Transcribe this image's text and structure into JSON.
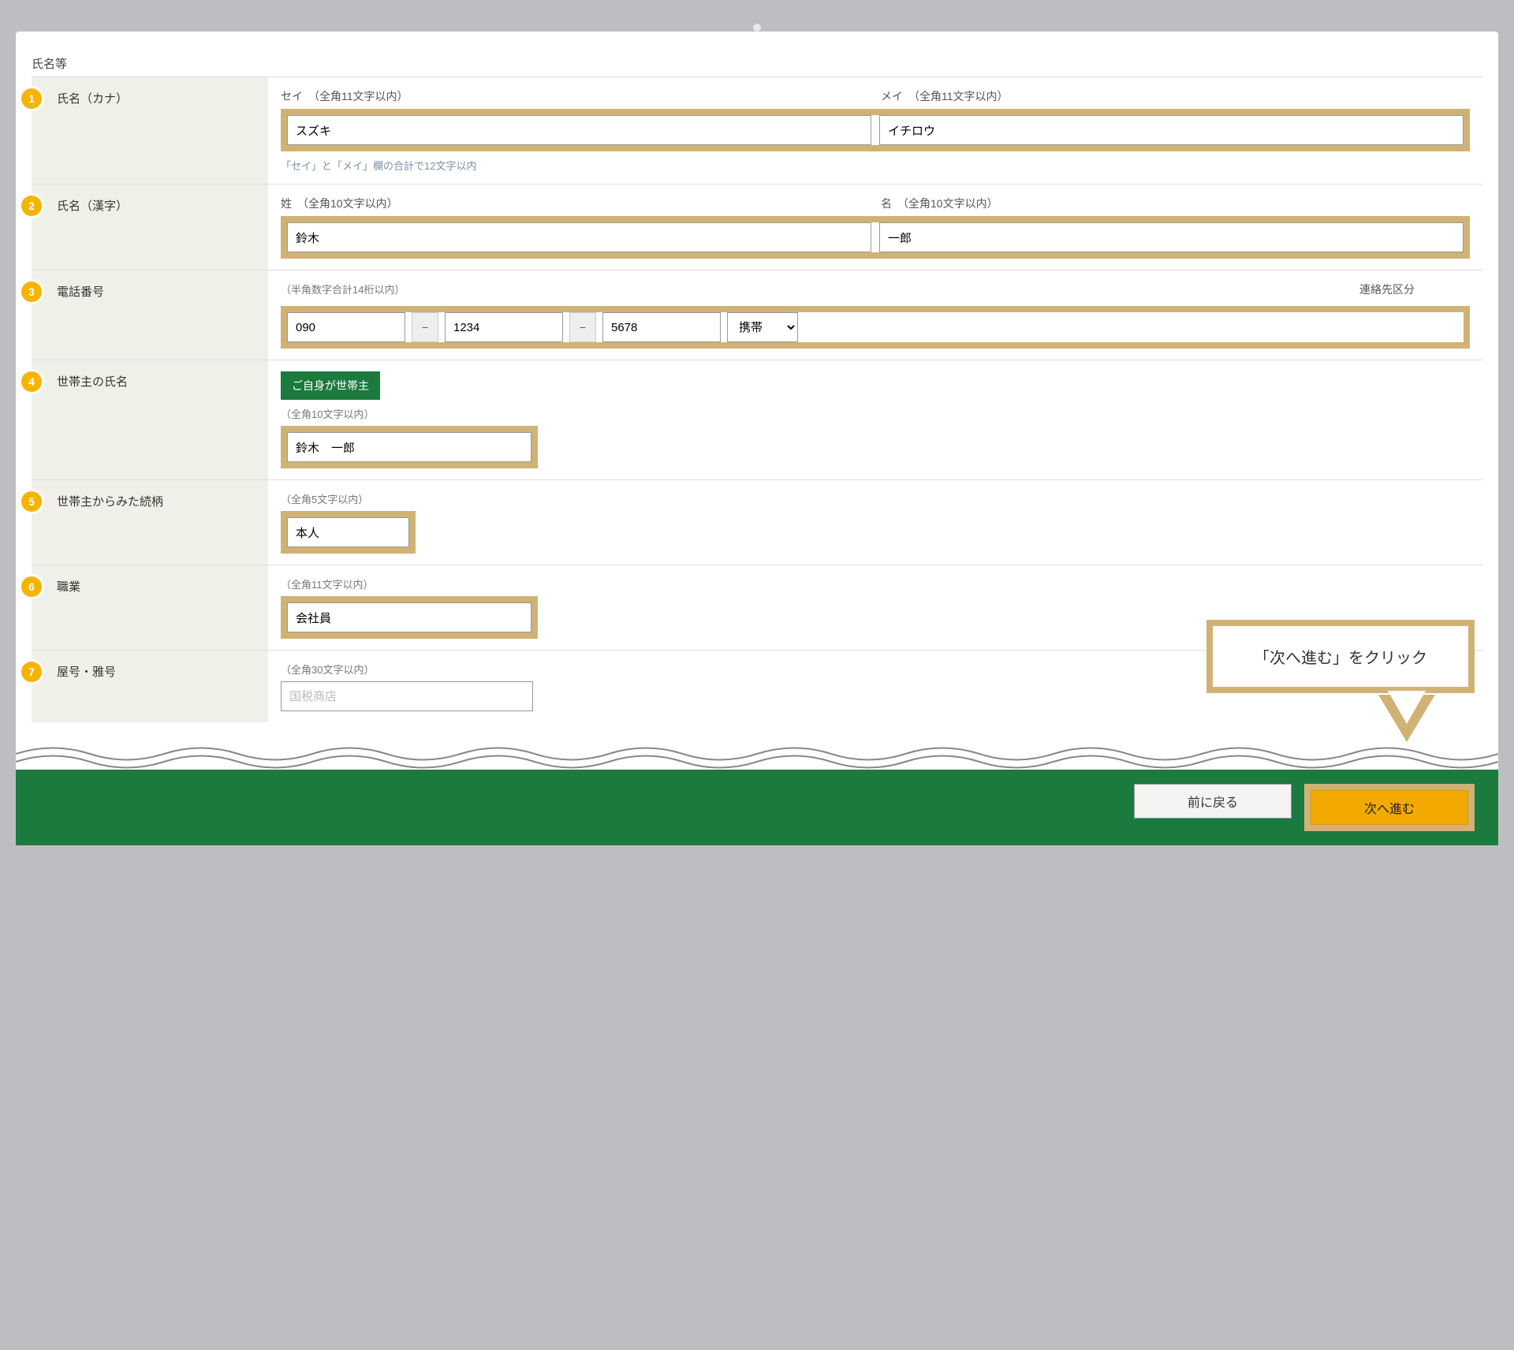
{
  "section_title": "氏名等",
  "rows": {
    "kana": {
      "badge": "1",
      "label": "氏名（カナ）",
      "sub_sei": "セイ　（全角11文字以内）",
      "sub_mei": "メイ　（全角11文字以内）",
      "val_sei": "スズキ",
      "val_mei": "イチロウ",
      "note": "「セイ」と「メイ」欄の合計で12文字以内"
    },
    "kanji": {
      "badge": "2",
      "label": "氏名（漢字）",
      "sub_sei": "姓　（全角10文字以内）",
      "sub_mei": "名　（全角10文字以内）",
      "val_sei": "鈴木",
      "val_mei": "一郎"
    },
    "phone": {
      "badge": "3",
      "label": "電話番号",
      "hint": "（半角数字合計14桁以内）",
      "right_label": "連絡先区分",
      "p1": "090",
      "p2": "1234",
      "p3": "5678",
      "dash": "−",
      "type": "携帯"
    },
    "head": {
      "badge": "4",
      "label": "世帯主の氏名",
      "btn": "ご自身が世帯主",
      "hint": "（全角10文字以内）",
      "val": "鈴木　一郎"
    },
    "relation": {
      "badge": "5",
      "label": "世帯主からみた続柄",
      "hint": "（全角5文字以内）",
      "val": "本人"
    },
    "job": {
      "badge": "6",
      "label": "職業",
      "hint": "（全角11文字以内）",
      "val": "会社員"
    },
    "trade": {
      "badge": "7",
      "label": "屋号・雅号",
      "hint": "（全角30文字以内）",
      "placeholder": "国税商店"
    }
  },
  "footer": {
    "back": "前に戻る",
    "next": "次へ進む"
  },
  "callout": "「次へ進む」をクリック"
}
